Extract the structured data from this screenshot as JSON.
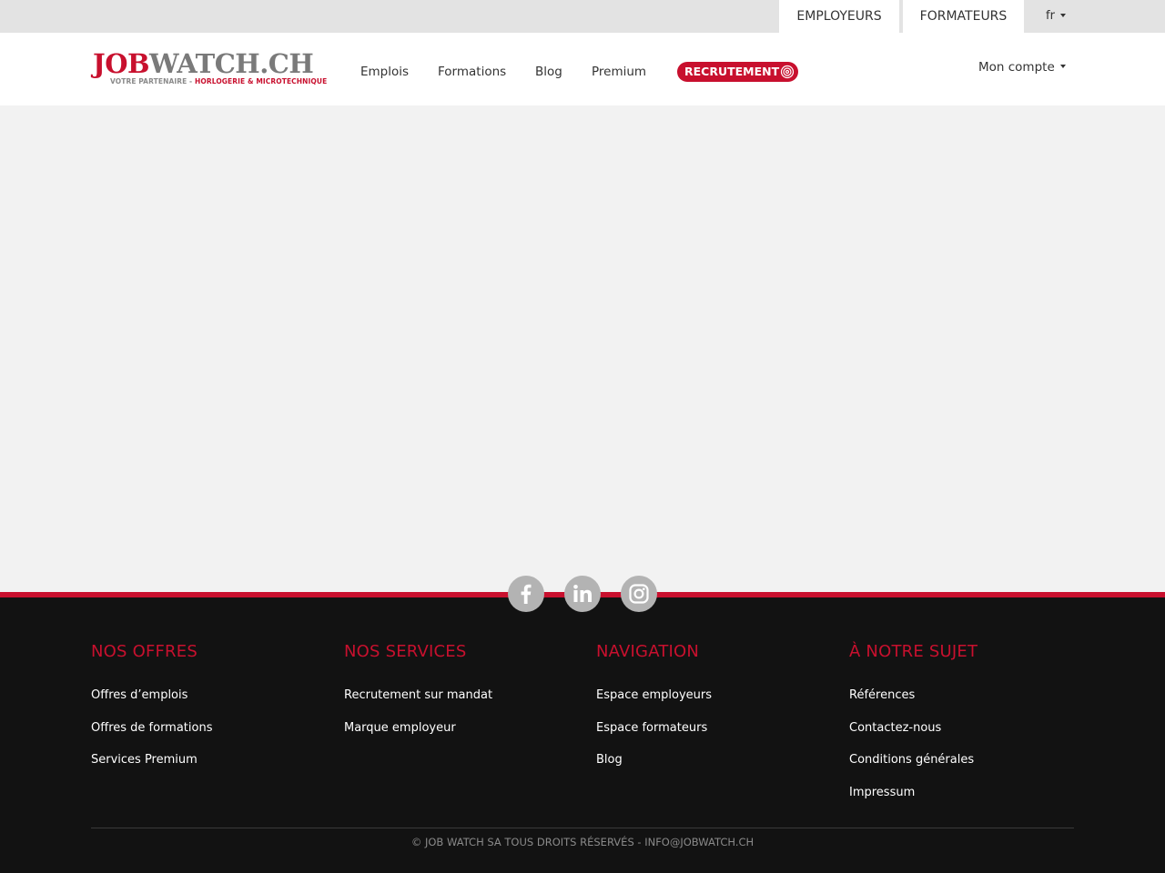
{
  "topbar": {
    "employers_label": "EMPLOYEURS",
    "trainers_label": "FORMATEURS",
    "language": "fr"
  },
  "logo": {
    "part1": "JOB",
    "part2": "WATCH.CH",
    "tagline_a": "VOTRE PARTENAIRE - ",
    "tagline_b": "HORLOGERIE & MICROTECHNIQUE"
  },
  "nav": {
    "emplois": "Emplois",
    "formations": "Formations",
    "blog": "Blog",
    "premium": "Premium",
    "recrutement": "RECRUTEMENT",
    "account": "Mon compte"
  },
  "social": {
    "icons": [
      "facebook-icon",
      "linkedin-icon",
      "instagram-icon"
    ]
  },
  "footer": {
    "columns": [
      {
        "title": "NOS OFFRES",
        "links": [
          "Offres d’emplois",
          "Offres de formations",
          "Services Premium"
        ]
      },
      {
        "title": "NOS SERVICES",
        "links": [
          "Recrutement sur mandat",
          "Marque employeur"
        ]
      },
      {
        "title": "NAVIGATION",
        "links": [
          "Espace employeurs",
          "Espace formateurs",
          "Blog"
        ]
      },
      {
        "title": "À NOTRE SUJET",
        "links": [
          "Références",
          "Contactez-nous",
          "Conditions générales",
          "Impressum"
        ]
      }
    ],
    "copyright": "© JOB WATCH SA TOUS DROITS RÉSERVÉS - INFO@JOBWATCH.CH"
  },
  "colors": {
    "brand_red": "#c8102e",
    "footer_bg": "#121212",
    "page_bg": "#f2f2f2"
  }
}
